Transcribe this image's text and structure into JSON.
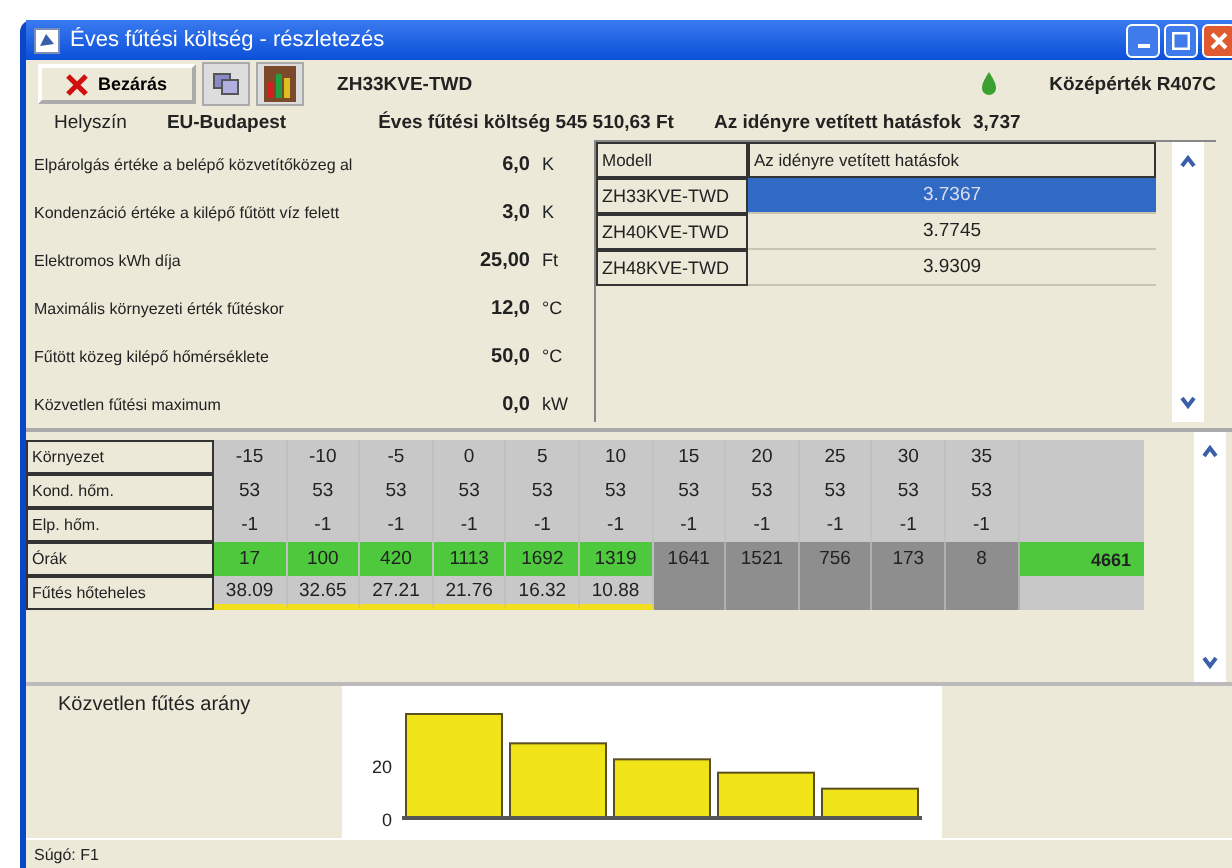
{
  "window": {
    "title": "Éves fűtési költség - részletezés"
  },
  "toolbar": {
    "close_button": "Bezárás",
    "model": "ZH33KVE-TWD",
    "refrigerant": "Középérték R407C"
  },
  "info": {
    "location_label": "Helyszín",
    "location": "EU-Budapest",
    "annual_cost": "Éves fűtési költség 545 510,63 Ft",
    "efficiency_label": "Az idényre vetített hatásfok",
    "efficiency": "3,737"
  },
  "parameters": [
    {
      "label": "Elpárolgás értéke a belépő közvetítőközeg al",
      "value": "6,0",
      "unit": "K"
    },
    {
      "label": "Kondenzáció értéke a kilépő fűtött víz felett",
      "value": "3,0",
      "unit": "K"
    },
    {
      "label": "Elektromos kWh díja",
      "value": "25,00",
      "unit": "Ft"
    },
    {
      "label": "Maximális környezeti érték fűtéskor",
      "value": "12,0",
      "unit": "°C"
    },
    {
      "label": "Fűtött közeg kilépő hőmérséklete",
      "value": "50,0",
      "unit": "°C"
    },
    {
      "label": "Közvetlen fűtési maximum",
      "value": "0,0",
      "unit": "kW"
    }
  ],
  "models": {
    "columns": [
      "Modell",
      "Az idényre vetített hatásfok"
    ],
    "rows": [
      {
        "model": "ZH33KVE-TWD",
        "efficiency": "3.7367",
        "selected": true
      },
      {
        "model": "ZH40KVE-TWD",
        "efficiency": "3.7745",
        "selected": false
      },
      {
        "model": "ZH48KVE-TWD",
        "efficiency": "3.9309",
        "selected": false
      }
    ]
  },
  "grid": {
    "rows": [
      {
        "label": "Környezet",
        "cells": [
          "-15",
          "-10",
          "-5",
          "0",
          "5",
          "10",
          "15",
          "20",
          "25",
          "30",
          "35"
        ]
      },
      {
        "label": "Kond. hőm.",
        "cells": [
          "53",
          "53",
          "53",
          "53",
          "53",
          "53",
          "53",
          "53",
          "53",
          "53",
          "53"
        ]
      },
      {
        "label": "Elp. hőm.",
        "cells": [
          "-1",
          "-1",
          "-1",
          "-1",
          "-1",
          "-1",
          "-1",
          "-1",
          "-1",
          "-1",
          "-1"
        ]
      }
    ],
    "hours": {
      "label": "Órák",
      "total": "4661",
      "cells": [
        {
          "value": "17",
          "heating": true
        },
        {
          "value": "100",
          "heating": true
        },
        {
          "value": "420",
          "heating": true
        },
        {
          "value": "1113",
          "heating": true
        },
        {
          "value": "1692",
          "heating": true
        },
        {
          "value": "1319",
          "heating": true
        },
        {
          "value": "1641",
          "heating": false
        },
        {
          "value": "1521",
          "heating": false
        },
        {
          "value": "756",
          "heating": false
        },
        {
          "value": "173",
          "heating": false
        },
        {
          "value": "8",
          "heating": false
        }
      ]
    },
    "load": {
      "label": "Fűtés hőteheles",
      "cells": [
        "38.09",
        "32.65",
        "27.21",
        "21.76",
        "16.32",
        "10.88"
      ]
    }
  },
  "ratio_chart": {
    "label": "Közvetlen fűtés arány",
    "chart_data": {
      "type": "bar",
      "values": [
        39,
        28,
        22,
        17,
        11
      ],
      "yticks": [
        0,
        20
      ],
      "ylim": [
        0,
        42
      ]
    }
  },
  "status_bar": "Súgó: F1"
}
